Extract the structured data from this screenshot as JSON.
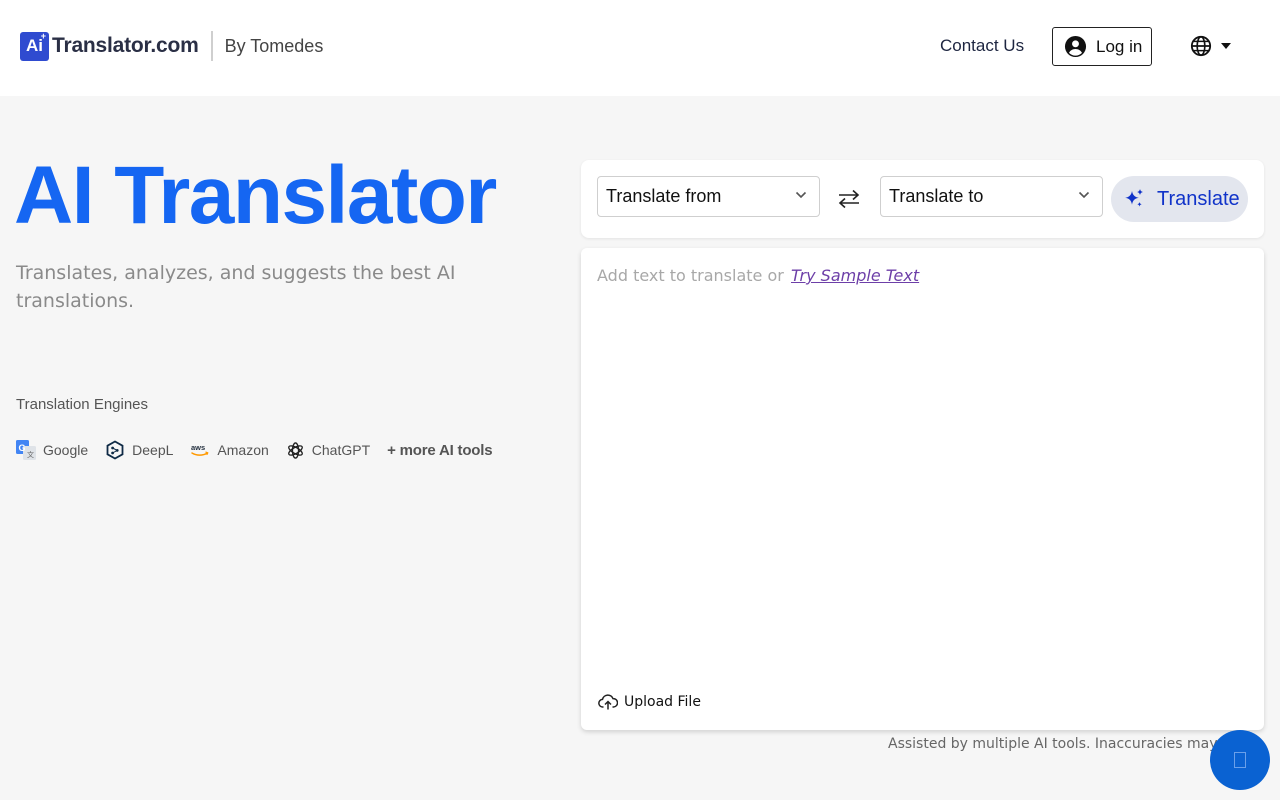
{
  "header": {
    "logo_mark": "Ai",
    "logo_plus": "+",
    "logo_text": "Translator.com",
    "logo_by": "By Tomedes",
    "contact": "Contact Us",
    "login": "Log in"
  },
  "hero": {
    "title": "AI Translator",
    "subtitle": "Translates, analyzes, and suggests the best AI translations.",
    "engines_label": "Translation Engines",
    "engines": [
      {
        "name": "Google",
        "icon": "google-translate-icon"
      },
      {
        "name": "DeepL",
        "icon": "deepl-icon"
      },
      {
        "name": "Amazon",
        "icon": "aws-icon"
      },
      {
        "name": "ChatGPT",
        "icon": "chatgpt-icon"
      }
    ],
    "more_tools": "+ more AI tools"
  },
  "translator": {
    "from_label": "Translate from",
    "to_label": "Translate to",
    "translate_button": "Translate",
    "placeholder": "Add text to translate or",
    "sample_link": "Try Sample Text",
    "upload": "Upload File",
    "disclaimer": "Assisted by multiple AI tools. Inaccuracies may"
  },
  "colors": {
    "brand_blue": "#1566f2",
    "logo_blue": "#2f4bd0",
    "translate_text": "#1033c9",
    "sample_link": "#6d3fa8",
    "fab": "#0a62d2"
  }
}
